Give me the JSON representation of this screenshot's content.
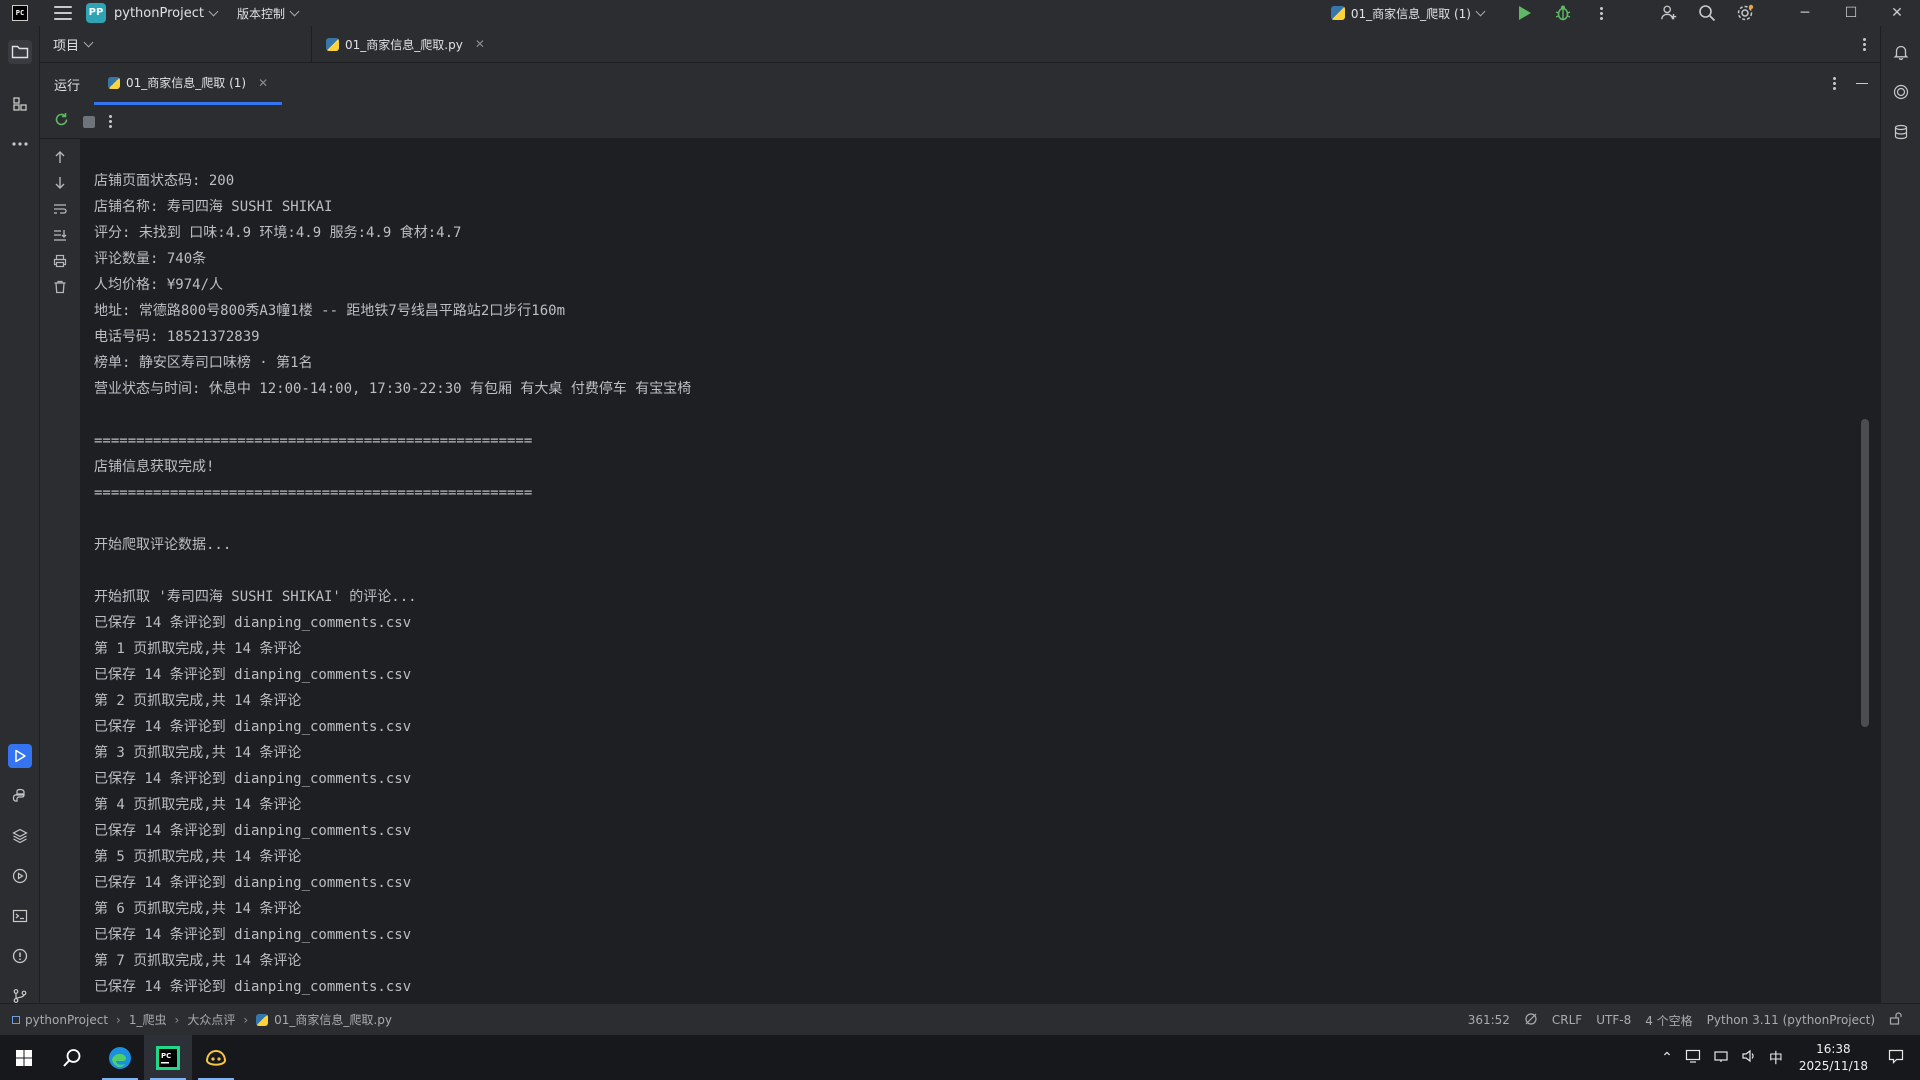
{
  "titlebar": {
    "app_logo": "PC",
    "project_badge": "PP",
    "project_name": "pythonProject",
    "vcs_label": "版本控制",
    "run_config": "01_商家信息_爬取 (1)",
    "window_buttons": {
      "minimize": "─",
      "maximize": "☐",
      "close": "✕"
    }
  },
  "header": {
    "project_panel_title": "项目",
    "editor_tab": "01_商家信息_爬取.py"
  },
  "run_panel": {
    "label": "运行",
    "tab": "01_商家信息_爬取 (1)"
  },
  "console": {
    "lines": [
      "店铺页面状态码: 200",
      "店铺名称: 寿司四海 SUSHI SHIKAI",
      "评分: 未找到 口味:4.9 环境:4.9 服务:4.9 食材:4.7",
      "评论数量: 740条",
      "人均价格: ¥974/人",
      "地址: 常德路800号800秀A3幢1楼 -- 距地铁7号线昌平路站2口步行160m",
      "电话号码: 18521372839",
      "榜单: 静安区寿司口味榜 · 第1名",
      "营业状态与时间: 休息中 12:00-14:00, 17:30-22:30 有包厢 有大桌 付费停车 有宝宝椅",
      "",
      "====================================================",
      "店铺信息获取完成!",
      "====================================================",
      "",
      "开始爬取评论数据...",
      "",
      "开始抓取 '寿司四海 SUSHI SHIKAI' 的评论...",
      "已保存 14 条评论到 dianping_comments.csv",
      "第 1 页抓取完成,共 14 条评论",
      "已保存 14 条评论到 dianping_comments.csv",
      "第 2 页抓取完成,共 14 条评论",
      "已保存 14 条评论到 dianping_comments.csv",
      "第 3 页抓取完成,共 14 条评论",
      "已保存 14 条评论到 dianping_comments.csv",
      "第 4 页抓取完成,共 14 条评论",
      "已保存 14 条评论到 dianping_comments.csv",
      "第 5 页抓取完成,共 14 条评论",
      "已保存 14 条评论到 dianping_comments.csv",
      "第 6 页抓取完成,共 14 条评论",
      "已保存 14 条评论到 dianping_comments.csv",
      "第 7 页抓取完成,共 14 条评论",
      "已保存 14 条评论到 dianping_comments.csv"
    ]
  },
  "statusbar": {
    "breadcrumbs": [
      "pythonProject",
      "1_爬虫",
      "大众点评",
      "01_商家信息_爬取.py"
    ],
    "position": "361:52",
    "line_ending": "CRLF",
    "encoding": "UTF-8",
    "indent": "4 个空格",
    "interpreter": "Python 3.11 (pythonProject)"
  },
  "taskbar": {
    "ime": "中",
    "time": "16:38",
    "date": "2025/11/18"
  },
  "colors": {
    "accent": "#3574f0",
    "run_green": "#5fb865",
    "panel_bg": "#2b2d30",
    "editor_bg": "#1e1f22"
  }
}
